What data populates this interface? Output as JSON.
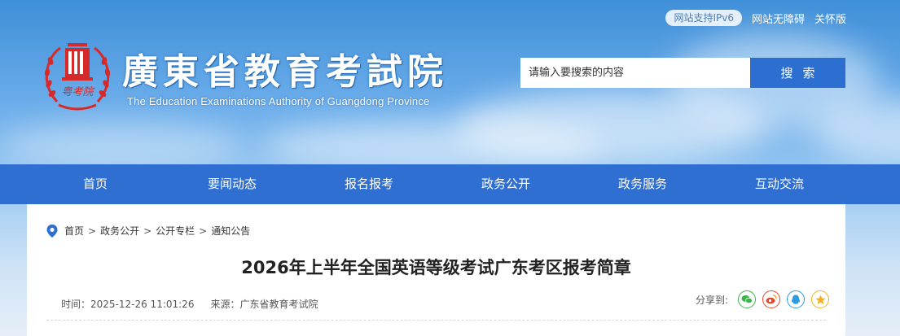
{
  "header": {
    "ipv6_badge": "网站支持IPv6",
    "accessibility_link": "网站无障碍",
    "elderly_link": "关怀版",
    "site_title": "廣東省教育考試院",
    "site_subtitle": "The Education Examinations Authority of Guangdong Province",
    "emblem_text": "粤考院"
  },
  "search": {
    "placeholder": "请输入要搜索的内容",
    "button_label": "搜索"
  },
  "nav": {
    "items": [
      {
        "label": "首页"
      },
      {
        "label": "要闻动态"
      },
      {
        "label": "报名报考"
      },
      {
        "label": "政务公开"
      },
      {
        "label": "政务服务"
      },
      {
        "label": "互动交流"
      }
    ]
  },
  "breadcrumb": {
    "items": [
      "首页",
      "政务公开",
      "公开专栏",
      "通知公告"
    ],
    "separator": ">"
  },
  "article": {
    "title": "2026年上半年全国英语等级考试广东考区报考简章",
    "time_label": "时间：2025-12-26 11:01:26",
    "source_label": "来源：广东省教育考试院"
  },
  "share": {
    "label": "分享到:",
    "icons": [
      "wechat-icon",
      "weibo-icon",
      "qq-icon",
      "qzone-icon"
    ]
  },
  "colors": {
    "nav_bg": "#2f6fd2",
    "search_button": "#2c6fd0",
    "emblem_red": "#d62a2a",
    "wechat": "#3bb54a",
    "weibo": "#e6462a",
    "qq": "#2c9be0",
    "qzone": "#f0b31d"
  }
}
